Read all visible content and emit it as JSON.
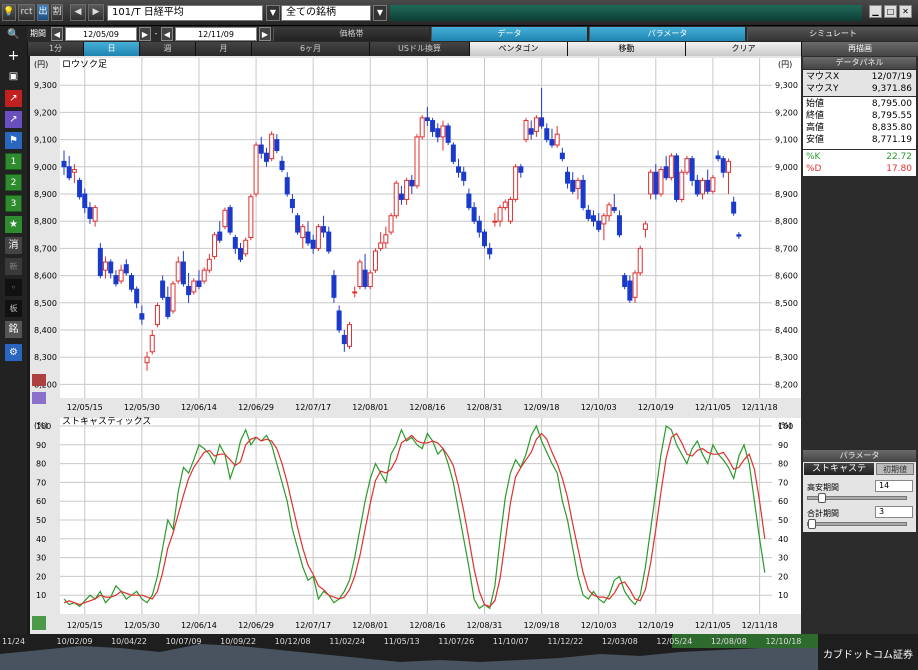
{
  "window": {
    "symbol": "101/T 日経平均",
    "filter": "全ての銘柄",
    "buttons": [
      "rct",
      "出",
      "割"
    ]
  },
  "toolbar2": {
    "period_label": "期間",
    "date_from": "12/05/09",
    "date_to": "12/11/09",
    "tabs": [
      {
        "label": "価格帯",
        "state": "normal"
      },
      {
        "label": "データ",
        "state": "active"
      },
      {
        "label": "パラメータ",
        "state": "active"
      },
      {
        "label": "シミュレート",
        "state": "dim"
      }
    ]
  },
  "toolbar3": {
    "intervals": [
      {
        "label": "1分",
        "state": "normal"
      },
      {
        "label": "日",
        "state": "active"
      },
      {
        "label": "週",
        "state": "normal"
      },
      {
        "label": "月",
        "state": "normal"
      },
      {
        "label": "6ヶ月",
        "state": "normal"
      },
      {
        "label": "USドル換算",
        "state": "normal"
      },
      {
        "label": "ペンタゴン",
        "state": "light"
      },
      {
        "label": "移動",
        "state": "light"
      },
      {
        "label": "クリア",
        "state": "light"
      },
      {
        "label": "再描画",
        "state": "grey"
      }
    ]
  },
  "sidebar": {
    "numbers": [
      "1",
      "2",
      "3"
    ],
    "labels": [
      "消",
      "新",
      "板",
      "銘"
    ]
  },
  "data_panel": {
    "title": "データパネル",
    "mouse_x_label": "マウスX",
    "mouse_x": "12/07/19",
    "mouse_y_label": "マウスY",
    "mouse_y": "9,371.86",
    "open_label": "始値",
    "open": "8,795.00",
    "close_label": "終値",
    "close": "8,795.55",
    "high_label": "高値",
    "high": "8,835.80",
    "low_label": "安値",
    "low": "8,771.19",
    "k_label": "%K",
    "k": "22.72",
    "d_label": "%D",
    "d": "17.80"
  },
  "param_panel": {
    "title": "パラメータ",
    "tab": "ストキャステ",
    "reset": "初期値",
    "p1_label": "高安期間",
    "p1_value": "14",
    "p2_label": "合計期間",
    "p2_value": "3"
  },
  "navigator": {
    "labels": [
      "11/24",
      "10/02/09",
      "10/04/22",
      "10/07/09",
      "10/09/22",
      "10/12/08",
      "11/02/24",
      "11/05/13",
      "11/07/26",
      "11/10/07",
      "11/12/22",
      "12/03/08",
      "12/05/24",
      "12/08/08",
      "12/10/18"
    ],
    "brand": "カブドットコム証券"
  },
  "chart_data": [
    {
      "type": "candlestick",
      "title": "ロウソク足",
      "ylabel": "(円)",
      "ylim": [
        8150,
        9400
      ],
      "yticks": [
        8200,
        8300,
        8400,
        8500,
        8600,
        8700,
        8800,
        8900,
        9000,
        9100,
        9200,
        9300
      ],
      "ytick_labels": [
        "8,200",
        "8,300",
        "8,400",
        "8,500",
        "8,600",
        "8,700",
        "8,800",
        "8,900",
        "9,000",
        "9,100",
        "9,200",
        "9,300"
      ],
      "xtick_labels": [
        "12/05/15",
        "12/05/30",
        "12/06/14",
        "12/06/29",
        "12/07/17",
        "12/08/01",
        "12/08/16",
        "12/08/31",
        "12/09/18",
        "12/10/03",
        "12/10/19",
        "12/11/05",
        "12/11/18"
      ],
      "xtick_index": [
        4,
        15,
        26,
        37,
        48,
        59,
        70,
        81,
        92,
        103,
        114,
        125,
        134
      ],
      "colors": {
        "up": "#e03030",
        "down": "#1a3acc"
      },
      "candles": [
        [
          9020,
          9060,
          8970,
          9000
        ],
        [
          9000,
          9040,
          8950,
          8960
        ],
        [
          8980,
          9010,
          8940,
          8990
        ],
        [
          8950,
          8960,
          8880,
          8890
        ],
        [
          8900,
          8920,
          8830,
          8850
        ],
        [
          8850,
          8870,
          8790,
          8810
        ],
        [
          8800,
          8860,
          8780,
          8850
        ],
        [
          8700,
          8720,
          8590,
          8600
        ],
        [
          8620,
          8670,
          8590,
          8650
        ],
        [
          8650,
          8660,
          8590,
          8610
        ],
        [
          8600,
          8620,
          8560,
          8570
        ],
        [
          8580,
          8640,
          8570,
          8620
        ],
        [
          8640,
          8660,
          8600,
          8610
        ],
        [
          8600,
          8610,
          8540,
          8550
        ],
        [
          8550,
          8560,
          8480,
          8500
        ],
        [
          8460,
          8490,
          8420,
          8440
        ],
        [
          8280,
          8320,
          8250,
          8300
        ],
        [
          8320,
          8400,
          8310,
          8380
        ],
        [
          8420,
          8500,
          8410,
          8490
        ],
        [
          8580,
          8600,
          8510,
          8520
        ],
        [
          8520,
          8560,
          8440,
          8450
        ],
        [
          8470,
          8580,
          8460,
          8570
        ],
        [
          8580,
          8670,
          8570,
          8650
        ],
        [
          8650,
          8690,
          8560,
          8570
        ],
        [
          8560,
          8610,
          8500,
          8530
        ],
        [
          8540,
          8590,
          8530,
          8580
        ],
        [
          8580,
          8620,
          8550,
          8560
        ],
        [
          8580,
          8630,
          8570,
          8620
        ],
        [
          8620,
          8680,
          8610,
          8660
        ],
        [
          8670,
          8760,
          8660,
          8750
        ],
        [
          8760,
          8800,
          8720,
          8730
        ],
        [
          8780,
          8850,
          8770,
          8840
        ],
        [
          8850,
          8860,
          8750,
          8760
        ],
        [
          8740,
          8750,
          8680,
          8700
        ],
        [
          8700,
          8720,
          8650,
          8660
        ],
        [
          8680,
          8740,
          8670,
          8730
        ],
        [
          8740,
          8900,
          8730,
          8890
        ],
        [
          8900,
          9090,
          8890,
          9080
        ],
        [
          9080,
          9110,
          9030,
          9050
        ],
        [
          9050,
          9070,
          9000,
          9020
        ],
        [
          9030,
          9130,
          9020,
          9120
        ],
        [
          9100,
          9120,
          9050,
          9060
        ],
        [
          9020,
          9040,
          8980,
          8990
        ],
        [
          8960,
          8980,
          8890,
          8900
        ],
        [
          8880,
          8900,
          8830,
          8850
        ],
        [
          8820,
          8830,
          8750,
          8760
        ],
        [
          8740,
          8790,
          8700,
          8780
        ],
        [
          8760,
          8800,
          8710,
          8720
        ],
        [
          8730,
          8750,
          8680,
          8700
        ],
        [
          8700,
          8790,
          8690,
          8780
        ],
        [
          8780,
          8820,
          8740,
          8760
        ],
        [
          8760,
          8780,
          8680,
          8690
        ],
        [
          8600,
          8620,
          8500,
          8520
        ],
        [
          8470,
          8490,
          8390,
          8400
        ],
        [
          8380,
          8400,
          8320,
          8350
        ],
        [
          8340,
          8430,
          8330,
          8420
        ],
        [
          8540,
          8560,
          8520,
          8540
        ],
        [
          8560,
          8660,
          8550,
          8650
        ],
        [
          8620,
          8680,
          8550,
          8560
        ],
        [
          8560,
          8620,
          8550,
          8610
        ],
        [
          8620,
          8700,
          8610,
          8690
        ],
        [
          8700,
          8760,
          8690,
          8720
        ],
        [
          8720,
          8780,
          8700,
          8750
        ],
        [
          8760,
          8830,
          8750,
          8820
        ],
        [
          8820,
          8950,
          8810,
          8940
        ],
        [
          8900,
          8930,
          8860,
          8880
        ],
        [
          8880,
          8960,
          8860,
          8950
        ],
        [
          8950,
          8970,
          8900,
          8930
        ],
        [
          8930,
          9120,
          8920,
          9110
        ],
        [
          9110,
          9190,
          9100,
          9180
        ],
        [
          9180,
          9220,
          9150,
          9170
        ],
        [
          9170,
          9180,
          9110,
          9130
        ],
        [
          9140,
          9160,
          9090,
          9110
        ],
        [
          9110,
          9170,
          9060,
          9150
        ],
        [
          9150,
          9160,
          9080,
          9090
        ],
        [
          9080,
          9090,
          9010,
          9020
        ],
        [
          9000,
          9030,
          8960,
          8980
        ],
        [
          8980,
          9000,
          8930,
          8950
        ],
        [
          8900,
          8920,
          8840,
          8850
        ],
        [
          8850,
          8870,
          8790,
          8800
        ],
        [
          8800,
          8820,
          8740,
          8760
        ],
        [
          8760,
          8770,
          8700,
          8710
        ],
        [
          8700,
          8720,
          8660,
          8680
        ],
        [
          8800,
          8830,
          8780,
          8800
        ],
        [
          8800,
          8860,
          8780,
          8850
        ],
        [
          8850,
          8880,
          8840,
          8870
        ],
        [
          8800,
          8890,
          8790,
          8880
        ],
        [
          8880,
          9010,
          8870,
          9000
        ],
        [
          9000,
          9010,
          8960,
          8980
        ],
        [
          9100,
          9180,
          9090,
          9170
        ],
        [
          9140,
          9170,
          9100,
          9120
        ],
        [
          9130,
          9190,
          9110,
          9180
        ],
        [
          9180,
          9290,
          9140,
          9150
        ],
        [
          9140,
          9160,
          9090,
          9100
        ],
        [
          9100,
          9140,
          9070,
          9080
        ],
        [
          9080,
          9150,
          9070,
          9120
        ],
        [
          9050,
          9070,
          9020,
          9030
        ],
        [
          8980,
          9000,
          8920,
          8940
        ],
        [
          8950,
          8980,
          8900,
          8910
        ],
        [
          8920,
          8960,
          8880,
          8950
        ],
        [
          8950,
          8970,
          8840,
          8850
        ],
        [
          8840,
          8860,
          8800,
          8810
        ],
        [
          8820,
          8840,
          8780,
          8800
        ],
        [
          8800,
          8830,
          8760,
          8770
        ],
        [
          8790,
          8830,
          8730,
          8820
        ],
        [
          8820,
          8870,
          8800,
          8860
        ],
        [
          8850,
          8900,
          8830,
          8840
        ],
        [
          8820,
          8840,
          8740,
          8750
        ],
        [
          8600,
          8610,
          8550,
          8560
        ],
        [
          8580,
          8600,
          8500,
          8510
        ],
        [
          8520,
          8620,
          8500,
          8610
        ],
        [
          8610,
          8710,
          8600,
          8700
        ],
        [
          8770,
          8800,
          8740,
          8790
        ],
        [
          8900,
          8990,
          8880,
          8980
        ],
        [
          8980,
          9010,
          8880,
          8900
        ],
        [
          8900,
          9000,
          8890,
          8990
        ],
        [
          9000,
          9040,
          8950,
          8960
        ],
        [
          8960,
          9050,
          8950,
          9040
        ],
        [
          9040,
          9050,
          8870,
          8880
        ],
        [
          8880,
          8990,
          8870,
          8980
        ],
        [
          8980,
          9040,
          8970,
          9030
        ],
        [
          9030,
          9040,
          8930,
          8950
        ],
        [
          8950,
          8970,
          8890,
          8900
        ],
        [
          8900,
          8960,
          8880,
          8950
        ],
        [
          8950,
          8990,
          8900,
          8910
        ],
        [
          8910,
          8970,
          8900,
          8960
        ],
        [
          9040,
          9060,
          9020,
          9030
        ],
        [
          9030,
          9040,
          8960,
          8980
        ],
        [
          8980,
          9030,
          8900,
          9020
        ],
        [
          8870,
          8890,
          8820,
          8830
        ],
        [
          8750,
          8760,
          8735,
          8745
        ]
      ]
    },
    {
      "type": "line",
      "title": "ストキャスティックス",
      "ylabel": "(%)",
      "ylim": [
        0,
        100
      ],
      "yticks": [
        10,
        20,
        30,
        40,
        50,
        60,
        70,
        80,
        90,
        100
      ],
      "xtick_labels": [
        "12/05/15",
        "12/05/30",
        "12/06/14",
        "12/06/29",
        "12/07/17",
        "12/08/01",
        "12/08/16",
        "12/08/31",
        "12/09/18",
        "12/10/03",
        "12/10/19",
        "12/11/05",
        "12/11/18"
      ],
      "xtick_index": [
        4,
        15,
        26,
        37,
        48,
        59,
        70,
        81,
        92,
        103,
        114,
        125,
        134
      ],
      "series": [
        {
          "name": "%K",
          "color": "#2a9a2a",
          "values": [
            8,
            5,
            6,
            4,
            7,
            10,
            8,
            12,
            6,
            9,
            15,
            12,
            8,
            10,
            12,
            8,
            6,
            10,
            20,
            35,
            50,
            45,
            65,
            78,
            75,
            82,
            90,
            88,
            85,
            80,
            90,
            85,
            72,
            80,
            92,
            98,
            90,
            94,
            92,
            95,
            90,
            80,
            70,
            60,
            45,
            35,
            25,
            18,
            20,
            8,
            12,
            10,
            6,
            8,
            12,
            18,
            30,
            45,
            60,
            72,
            80,
            75,
            70,
            85,
            90,
            98,
            92,
            94,
            90,
            88,
            96,
            92,
            85,
            88,
            80,
            70,
            55,
            40,
            25,
            8,
            3,
            5,
            3,
            15,
            40,
            62,
            75,
            82,
            78,
            85,
            95,
            100,
            92,
            86,
            80,
            75,
            60,
            50,
            35,
            20,
            10,
            8,
            12,
            8,
            6,
            10,
            18,
            20,
            12,
            8,
            5,
            10,
            25,
            45,
            65,
            85,
            100,
            98,
            90,
            85,
            80,
            88,
            92,
            85,
            80,
            90,
            85,
            82,
            78,
            72,
            84,
            90,
            80,
            60,
            40,
            22
          ]
        },
        {
          "name": "%D",
          "color": "#e03030",
          "values": [
            6,
            7,
            6,
            5,
            6,
            7,
            8,
            10,
            9,
            9,
            10,
            12,
            11,
            10,
            10,
            10,
            9,
            8,
            12,
            22,
            35,
            43,
            53,
            63,
            72,
            78,
            82,
            86,
            87,
            84,
            85,
            85,
            82,
            79,
            81,
            90,
            93,
            94,
            92,
            93,
            92,
            88,
            80,
            70,
            58,
            46,
            35,
            26,
            21,
            15,
            13,
            10,
            9,
            8,
            9,
            13,
            20,
            31,
            45,
            59,
            71,
            76,
            75,
            77,
            82,
            91,
            93,
            95,
            92,
            91,
            91,
            92,
            91,
            88,
            84,
            79,
            68,
            55,
            40,
            24,
            12,
            5,
            4,
            7,
            19,
            39,
            59,
            73,
            78,
            82,
            86,
            93,
            96,
            93,
            86,
            80,
            72,
            62,
            48,
            35,
            22,
            13,
            10,
            9,
            9,
            8,
            11,
            16,
            17,
            13,
            8,
            7,
            13,
            27,
            45,
            65,
            83,
            94,
            96,
            91,
            85,
            84,
            87,
            88,
            86,
            85,
            85,
            86,
            82,
            77,
            78,
            82,
            85,
            77,
            60,
            40
          ]
        }
      ]
    }
  ]
}
